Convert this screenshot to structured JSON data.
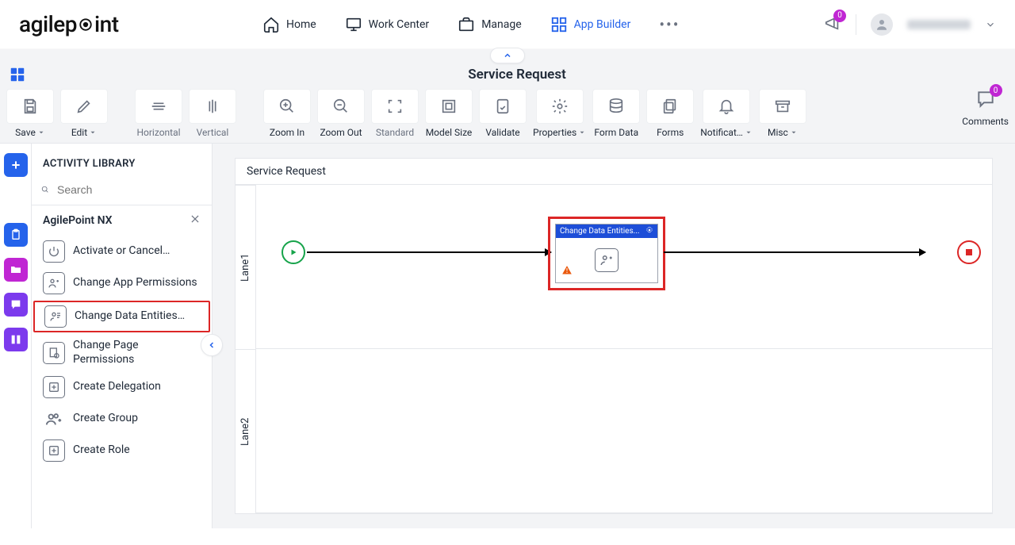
{
  "brand": "agilepoint",
  "nav": {
    "home": "Home",
    "workcenter": "Work Center",
    "manage": "Manage",
    "appbuilder": "App Builder"
  },
  "notifications_count": "0",
  "toolbar": {
    "save": "Save",
    "edit": "Edit",
    "horizontal": "Horizontal",
    "vertical": "Vertical",
    "zoomin": "Zoom In",
    "zoomout": "Zoom Out",
    "standard": "Standard",
    "modelsize": "Model Size",
    "validate": "Validate",
    "properties": "Properties",
    "formdata": "Form Data",
    "forms": "Forms",
    "notifications": "Notificat…",
    "misc": "Misc",
    "comments": "Comments",
    "comments_count": "0"
  },
  "page_title": "Service Request",
  "library": {
    "title": "ACTIVITY LIBRARY",
    "search_placeholder": "Search",
    "group": "AgilePoint NX",
    "items": {
      "activate": "Activate or Cancel…",
      "changeapp": "Change App Permissions",
      "changedata": "Change Data Entities…",
      "changepage": "Change Page Permissions",
      "createdelegation": "Create Delegation",
      "creategroup": "Create Group",
      "createrole": "Create Role"
    }
  },
  "canvas": {
    "title": "Service Request",
    "lane1": "Lane1",
    "lane2": "Lane2",
    "activity_label": "Change Data Entities..."
  }
}
